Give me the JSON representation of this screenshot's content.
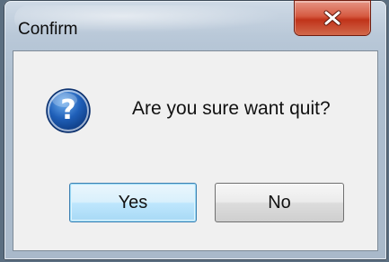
{
  "window": {
    "title": "Confirm",
    "close_icon": "close-icon"
  },
  "dialog": {
    "icon": "question-icon",
    "message": "Are you sure want quit?",
    "buttons": {
      "yes_label": "Yes",
      "no_label": "No"
    }
  },
  "colors": {
    "close_button": "#c7381f",
    "icon_blue": "#1f5fb8",
    "default_button_border": "#3c7fb1",
    "client_background": "#f0f0f0"
  }
}
